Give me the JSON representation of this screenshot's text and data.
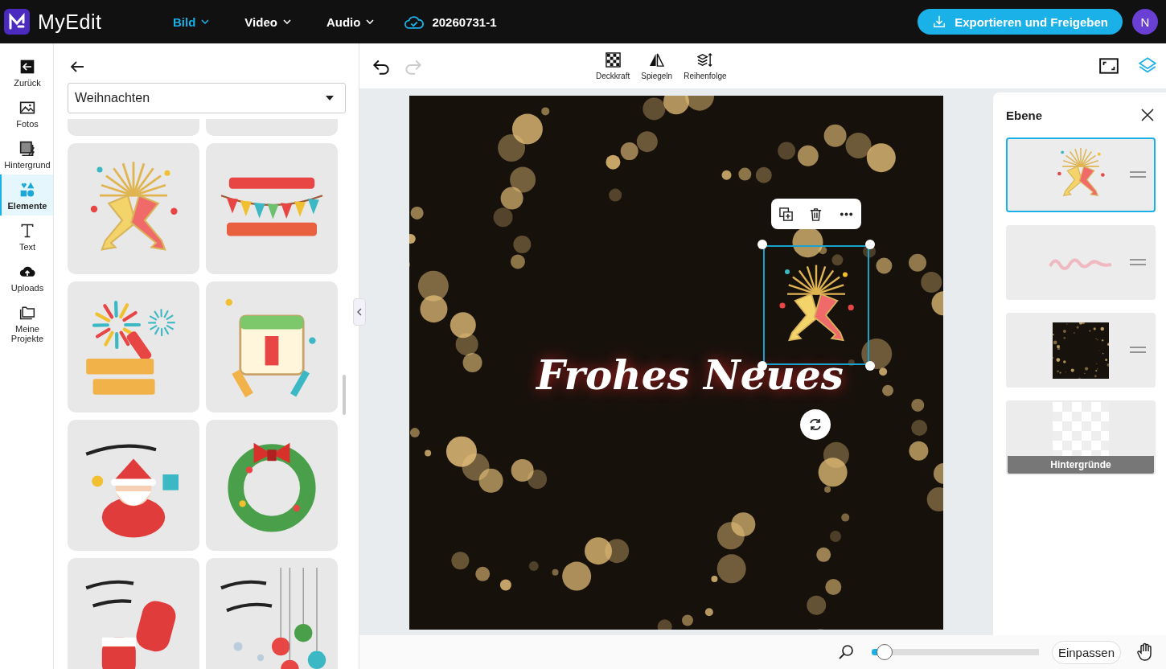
{
  "app": {
    "name": "MyEdit"
  },
  "menus": [
    {
      "label": "Bild",
      "selected": true
    },
    {
      "label": "Video",
      "selected": false
    },
    {
      "label": "Audio",
      "selected": false
    }
  ],
  "project": {
    "name": "20260731-1"
  },
  "export_button": "Exportieren und Freigeben",
  "avatar": "N",
  "nav": [
    {
      "label": "Zurück",
      "kind": "back",
      "selected": false
    },
    {
      "label": "Fotos",
      "kind": "photos",
      "selected": false
    },
    {
      "label": "Hintergrund",
      "kind": "background",
      "selected": false
    },
    {
      "label": "Elemente",
      "kind": "elements",
      "selected": true
    },
    {
      "label": "Text",
      "kind": "text",
      "selected": false
    },
    {
      "label": "Uploads",
      "kind": "uploads",
      "selected": false
    },
    {
      "label": "Meine Projekte",
      "kind": "projects",
      "selected": false
    }
  ],
  "panel": {
    "category": "Weihnachten",
    "stickers": [
      {
        "kind": "toast"
      },
      {
        "kind": "banner"
      },
      {
        "kind": "fireworks"
      },
      {
        "kind": "calendar"
      },
      {
        "kind": "santa"
      },
      {
        "kind": "wreath"
      },
      {
        "kind": "mittens"
      },
      {
        "kind": "ornaments"
      }
    ]
  },
  "toolbar": {
    "undo_disabled": false,
    "redo_disabled": true,
    "tools": [
      {
        "label": "Deckkraft",
        "kind": "opacity"
      },
      {
        "label": "Spiegeln",
        "kind": "flip"
      },
      {
        "label": "Reihenfolge",
        "kind": "order"
      }
    ],
    "layers_button": {
      "selected": true
    }
  },
  "canvas": {
    "text": "Frohes Neues"
  },
  "layer_panel": {
    "title": "Ebene",
    "layers": [
      {
        "kind": "sticker",
        "selected": true
      },
      {
        "kind": "text",
        "selected": false
      },
      {
        "kind": "photo",
        "selected": false
      },
      {
        "kind": "background",
        "selected": false,
        "label": "Hintergründe"
      }
    ]
  },
  "zoom": {
    "level": 0.05,
    "fit_button": "Einpassen"
  }
}
